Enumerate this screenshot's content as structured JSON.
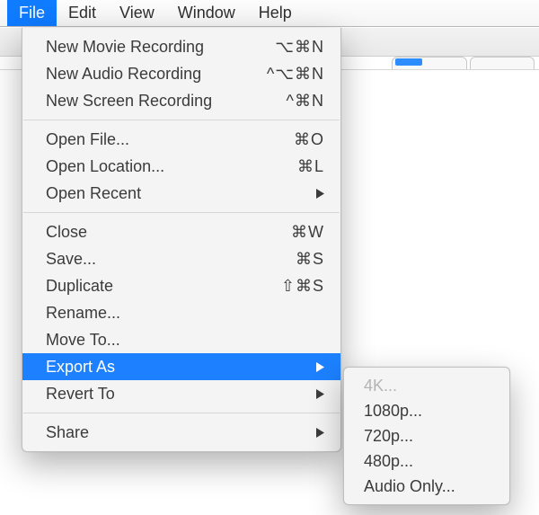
{
  "menubar": {
    "items": [
      {
        "label": "File",
        "selected": true
      },
      {
        "label": "Edit"
      },
      {
        "label": "View"
      },
      {
        "label": "Window"
      },
      {
        "label": "Help"
      }
    ]
  },
  "menu": {
    "groups": [
      [
        {
          "label": "New Movie Recording",
          "shortcut": "⌥⌘N"
        },
        {
          "label": "New Audio Recording",
          "shortcut": "^⌥⌘N"
        },
        {
          "label": "New Screen Recording",
          "shortcut": "^⌘N"
        }
      ],
      [
        {
          "label": "Open File...",
          "shortcut": "⌘O"
        },
        {
          "label": "Open Location...",
          "shortcut": "⌘L"
        },
        {
          "label": "Open Recent",
          "submenu": true
        }
      ],
      [
        {
          "label": "Close",
          "shortcut": "⌘W"
        },
        {
          "label": "Save...",
          "shortcut": "⌘S"
        },
        {
          "label": "Duplicate",
          "shortcut": "⇧⌘S"
        },
        {
          "label": "Rename..."
        },
        {
          "label": "Move To..."
        },
        {
          "label": "Export As",
          "submenu": true,
          "highlight": true
        },
        {
          "label": "Revert To",
          "submenu": true
        }
      ],
      [
        {
          "label": "Share",
          "submenu": true
        }
      ]
    ]
  },
  "submenu": {
    "items": [
      {
        "label": "4K...",
        "disabled": true
      },
      {
        "label": "1080p..."
      },
      {
        "label": "720p..."
      },
      {
        "label": "480p..."
      },
      {
        "label": "Audio Only..."
      }
    ]
  }
}
